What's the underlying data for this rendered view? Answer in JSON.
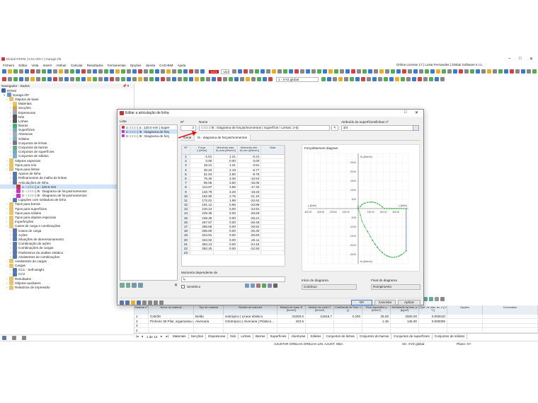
{
  "app": {
    "title": "Dlubal RFEM | 6.01.0017 | Garage.rf6",
    "license": "Online License 17 | Luisa Fernandes | Dlubal Software s.r.o."
  },
  "menu": [
    "Ficheiro",
    "Editar",
    "Vista",
    "Inserir",
    "Atribuir",
    "Calcular",
    "Resultados",
    "Ferramentas",
    "Opções",
    "Janela",
    "CAD-BIM",
    "Ajuda"
  ],
  "toolbar": {
    "load_case": "LC1",
    "load_case_name": "ULS (STR/GEO) - permanent...",
    "coord": "1 - XYZ global"
  },
  "navigator": {
    "title": "Navegador - Dados",
    "root": "RFEM",
    "model": "Garage.rf6*",
    "items": [
      {
        "label": "Objetos de base",
        "level": 1,
        "color": "#e8c36a"
      },
      {
        "label": "Materiais",
        "level": 2,
        "color": "#e8c36a"
      },
      {
        "label": "Secções",
        "level": 2,
        "color": "#d9a04b"
      },
      {
        "label": "Espessuras",
        "level": 2,
        "color": "#9ab"
      },
      {
        "label": "Nós",
        "level": 2,
        "color": "#555"
      },
      {
        "label": "Linhas",
        "level": 2,
        "color": "#555"
      },
      {
        "label": "Barras",
        "level": 2,
        "color": "#4a7"
      },
      {
        "label": "Superfícies",
        "level": 2,
        "color": "#7ab"
      },
      {
        "label": "Aberturas",
        "level": 2,
        "color": "#aaa"
      },
      {
        "label": "Sólidos",
        "level": 2,
        "color": "#8ac"
      },
      {
        "label": "Conjuntos de linhas",
        "level": 2,
        "color": "#777"
      },
      {
        "label": "Conjuntos de barras",
        "level": 2,
        "color": "#6a8"
      },
      {
        "label": "Conjuntos de superfícies",
        "level": 2,
        "color": "#7ab"
      },
      {
        "label": "Conjuntos de sólidos",
        "level": 2,
        "color": "#8ac"
      },
      {
        "label": "Objetos especiais",
        "level": 1,
        "color": "#e8c36a"
      },
      {
        "label": "Tipos para nós",
        "level": 1,
        "color": "#e8c36a"
      },
      {
        "label": "Tipos para linhas",
        "level": 1,
        "color": "#e8c36a"
      },
      {
        "label": "Apoios de linha",
        "level": 2,
        "color": "#57a"
      },
      {
        "label": "Refinamentos da malha de linhas",
        "level": 2,
        "color": "#57a"
      },
      {
        "label": "Articulações de linha",
        "level": 2,
        "color": "#57a"
      },
      {
        "label": "1 - □□□□ | a : 120.0 mm",
        "level": 3,
        "color": "#c33",
        "selected": true
      },
      {
        "label": "2 - □□□□ | l6 : Diagrama de forças/momentos",
        "level": 3,
        "color": "#c3c"
      },
      {
        "label": "3 - □□□□ | l6 : Diagrama de forças/momentos",
        "level": 3,
        "color": "#c3c"
      },
      {
        "label": "Ligações com soldadura de linha",
        "level": 2,
        "color": "#57a"
      },
      {
        "label": "Tipos para barras",
        "level": 1,
        "color": "#e8c36a"
      },
      {
        "label": "Tipos para superfícies",
        "level": 1,
        "color": "#e8c36a"
      },
      {
        "label": "Tipos para sólidos",
        "level": 1,
        "color": "#e8c36a"
      },
      {
        "label": "Tipos para objetos especiais",
        "level": 1,
        "color": "#e8c36a"
      },
      {
        "label": "Imperfeições",
        "level": 1,
        "color": "#e8c36a"
      },
      {
        "label": "Casos de carga e combinações",
        "level": 1,
        "color": "#e8c36a"
      },
      {
        "label": "Casos de carga",
        "level": 2,
        "color": "#57a"
      },
      {
        "label": "Ações",
        "level": 2,
        "color": "#57a"
      },
      {
        "label": "Situações de dimensionamento",
        "level": 2,
        "color": "#57a"
      },
      {
        "label": "Combinação de ações",
        "level": 2,
        "color": "#57a"
      },
      {
        "label": "Combinações de cargas",
        "level": 2,
        "color": "#57a"
      },
      {
        "label": "Parâmetros da análise estática",
        "level": 2,
        "color": "#57a"
      },
      {
        "label": "Assistentes de combinações",
        "level": 2,
        "color": "#57a"
      },
      {
        "label": "Assistentes de cargas",
        "level": 1,
        "color": "#e8c36a"
      },
      {
        "label": "Cargas",
        "level": 1,
        "color": "#e8c36a"
      },
      {
        "label": "CC1 - Self-weight",
        "level": 2,
        "color": "#57a"
      },
      {
        "label": "CC2",
        "level": 2,
        "color": "#57a"
      },
      {
        "label": "Resultados",
        "level": 1,
        "color": "#e8c36a"
      },
      {
        "label": "Objetos auxiliares",
        "level": 1,
        "color": "#e8c36a"
      },
      {
        "label": "Relatórios de impressão",
        "level": 1,
        "color": "#e8c36a"
      }
    ]
  },
  "dialog": {
    "title": "Editar a articulação de linha",
    "list_header": "Lista",
    "list_items": [
      {
        "label": "1 □□□□ | a : 120.0 mm | Super",
        "color": "#c33"
      },
      {
        "label": "2 □□□□ | l6 : Diagrama de forç",
        "color": "#c3c",
        "selected": true
      },
      {
        "label": "3 □□□□ | l6 : Diagrama de forç",
        "color": "#c3c"
      }
    ],
    "no_label": "Nº",
    "no_value": "2",
    "name_label": "Nome",
    "name_value": "□□□□ | l6 : Diagrama de forças/momentos | Superfície / Linhas: 2-5)",
    "assigned_label": "Atribuído às superfícies/linhas nº",
    "assigned_value": "3/4",
    "tabs": [
      "Geral",
      "l6 - diagrama de forças/momentos"
    ],
    "table_headers": [
      "Nº",
      "Força\nlₑ [kN/m]",
      "Momento máx.\nMₓ,máx [kNm/m]",
      "Momento mín.\nMₓ,mín [kNm/m]",
      "Nota"
    ],
    "table_rows": [
      [
        "1",
        "-1.01",
        "1.21",
        "-0.21",
        ""
      ],
      [
        "2",
        "0.00",
        "0.00",
        "0.00",
        ""
      ],
      [
        "3",
        "18.21",
        "1.21",
        "-3.51",
        ""
      ],
      [
        "4",
        "30.22",
        "2.18",
        "-6.77",
        ""
      ],
      [
        "5",
        "51.04",
        "2.90",
        "-9.78",
        ""
      ],
      [
        "6",
        "75.45",
        "3.36",
        "-12.54",
        ""
      ],
      [
        "7",
        "95.06",
        "3.50",
        "-15.05",
        ""
      ],
      [
        "8",
        "114.67",
        "3.55",
        "-17.32",
        ""
      ],
      [
        "9",
        "133.79",
        "3.28",
        "-19.33",
        ""
      ],
      [
        "10",
        "152.90",
        "2.75",
        "-21.10",
        ""
      ],
      [
        "11",
        "172.01",
        "1.98",
        "-22.62",
        ""
      ],
      [
        "12",
        "191.12",
        "0.96",
        "-23.89",
        ""
      ],
      [
        "13",
        "210.24",
        "0.00",
        "-24.91",
        ""
      ],
      [
        "14",
        "229.35",
        "0.00",
        "-25.69",
        ""
      ],
      [
        "15",
        "248.46",
        "0.00",
        "-26.21",
        ""
      ],
      [
        "16",
        "267.57",
        "0.00",
        "-26.49",
        ""
      ],
      [
        "17",
        "286.68",
        "0.00",
        "-26.52",
        ""
      ],
      [
        "18",
        "305.80",
        "0.00",
        "-26.30",
        ""
      ],
      [
        "19",
        "324.91",
        "0.00",
        "-25.83",
        ""
      ],
      [
        "20",
        "344.02",
        "0.00",
        "-25.11",
        ""
      ],
      [
        "21",
        "363.13",
        "0.00",
        "-24.15",
        ""
      ],
      [
        "22",
        "382.25",
        "0.00",
        "-22.93",
        ""
      ],
      [
        "23",
        "",
        "",
        "",
        ""
      ]
    ],
    "diagram_title": "Força/Moment diagram",
    "moment_label": "Momento dependente de",
    "moment_value": "lₑ",
    "symmetric_label": "Simétrico",
    "diagram_start_label": "Início do diagrama",
    "diagram_start_value": "Contínuo",
    "diagram_end_label": "Final do diagrama",
    "diagram_end_value": "Rompimento",
    "ok": "OK",
    "cancel": "Cancelar",
    "apply": "Aplicar"
  },
  "chart_data": {
    "type": "line",
    "title": "Força/Moment diagram",
    "xlabel": "lₑ [kN/m]",
    "ylabel": "Mₓ [kNm/m]",
    "xlim": [
      -400,
      400
    ],
    "ylim": [
      -30,
      30
    ],
    "x_ticks": [
      "-400.00",
      "-300.00",
      "-200.00",
      "-100.00",
      "100.00",
      "200.00",
      "300.00"
    ],
    "y_ticks": [
      "25.00",
      "20.00",
      "15.00",
      "10.00",
      "5.00",
      "-5.00",
      "-10.00",
      "-15.00",
      "-20.00",
      "-25.00"
    ],
    "series": [
      {
        "values_x": [
          -1.01,
          0,
          18.21,
          30.22,
          51.04,
          75.45,
          95.06,
          114.67,
          133.79,
          152.9,
          172.01,
          191.12,
          210.24,
          229.35,
          248.46,
          267.57,
          286.68,
          305.8,
          324.91,
          344.02,
          363.13,
          382.25
        ],
        "values_y": [
          1.21,
          0,
          1.21,
          2.18,
          2.9,
          3.36,
          3.5,
          3.55,
          3.28,
          2.75,
          1.98,
          0.96,
          0,
          0,
          0,
          0,
          0,
          0,
          0,
          0,
          0,
          0
        ]
      },
      {
        "values_x": [
          -1.01,
          0,
          18.21,
          30.22,
          51.04,
          75.45,
          95.06,
          114.67,
          133.79,
          152.9,
          172.01,
          191.12,
          210.24,
          229.35,
          248.46,
          267.57,
          286.68,
          305.8,
          324.91,
          344.02,
          363.13,
          382.25
        ],
        "values_y": [
          -0.21,
          0,
          -3.51,
          -6.77,
          -9.78,
          -12.54,
          -15.05,
          -17.32,
          -19.33,
          -21.1,
          -22.62,
          -23.89,
          -24.91,
          -25.69,
          -26.21,
          -26.49,
          -26.52,
          -26.3,
          -25.83,
          -25.11,
          -24.15,
          -22.93
        ]
      }
    ],
    "grid": true,
    "colors": {
      "line": "#3cb44b",
      "end": "#3b76c4"
    }
  },
  "bottom": {
    "headers": [
      "Material nº",
      "Nome do material",
      "Tipo de material",
      "Modelo de material",
      "Módulo de elast. E [N/mm²]",
      "Módulo de corte G [N/mm²]",
      "Coeficiente de Pois. ν [-]",
      "Peso específico γ [kN/m³]",
      "Densidade da mas. ρ [kg/m³]",
      "Coef. de dilat. ter. α [1/°C]",
      "Opções",
      "Comentário"
    ],
    "rows": [
      [
        "1",
        "C25/30",
        "Betão",
        "Isotrópico | Linear elástico",
        "31000.0",
        "12916.7",
        "0.200",
        "25.00",
        "2500.00",
        "0.000010",
        "",
        ""
      ],
      [
        "2",
        "Pinheiro 38 Pilar, argamassa de ciment...",
        "Alvenaria",
        "Ortotrópico | Alvenaria | Plástico...",
        "423.5",
        "",
        "",
        "1.45",
        "145.00",
        "0.000006",
        "",
        ""
      ],
      [
        "3",
        "",
        "",
        "",
        "",
        "",
        "",
        "",
        "",
        "",
        "",
        ""
      ],
      [
        "4",
        "",
        "",
        "",
        "",
        "",
        "",
        "",
        "",
        "",
        "",
        ""
      ]
    ],
    "pager": "1 de 13",
    "tabs": [
      "Materiais",
      "Secções",
      "Espessuras",
      "Nós",
      "Linhas",
      "Barras",
      "Superfícies",
      "Aberturas",
      "Sólidos",
      "Conjuntos de linhas",
      "Conjuntos de barras",
      "Conjuntos de superfícies",
      "Conjuntos de sólidos"
    ]
  },
  "status": {
    "snap": "AJUSTAR GRELHA GRELHA LIN. AJUST. OBJ.",
    "cs": "SC: XYZ global",
    "plane": "Plano: XY"
  }
}
